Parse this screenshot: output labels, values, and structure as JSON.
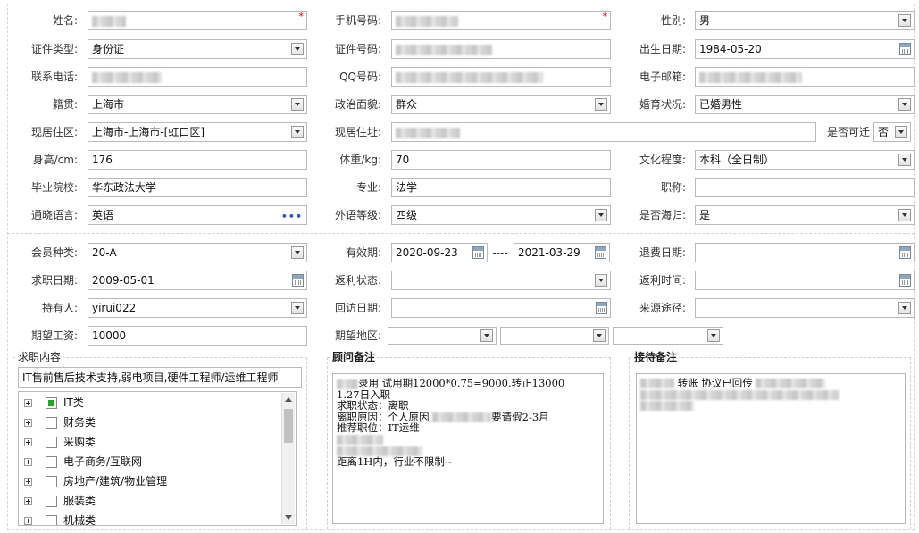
{
  "labels": {
    "name": "姓名:",
    "mobile": "手机号码:",
    "gender": "性别:",
    "id_type": "证件类型:",
    "id_no": "证件号码:",
    "birth": "出生日期:",
    "phone": "联系电话:",
    "qq": "QQ号码:",
    "email": "电子邮箱:",
    "native": "籍贯:",
    "politics": "政治面貌:",
    "marital": "婚育状况:",
    "district": "现居住区:",
    "address": "现居住址:",
    "relocate": "是否可迁",
    "height": "身高/cm:",
    "weight": "体重/kg:",
    "education": "文化程度:",
    "school": "毕业院校:",
    "major": "专业:",
    "title": "职称:",
    "language": "通晓语言:",
    "lang_level": "外语等级:",
    "overseas": "是否海归:",
    "member_type": "会员种类:",
    "valid": "有效期:",
    "refund_date": "退费日期:",
    "job_date": "求职日期:",
    "rebate_status": "返利状态:",
    "rebate_time": "返利时间:",
    "holder": "持有人:",
    "visit_date": "回访日期:",
    "source": "来源途径:",
    "salary": "期望工资:",
    "area": "期望地区:"
  },
  "values": {
    "gender": "男",
    "id_type": "身份证",
    "birth": "1984-05-20",
    "native": "上海市",
    "politics": "群众",
    "marital": "已婚男性",
    "district": "上海市-上海市-[虹口区]",
    "relocate": "否",
    "height": "176",
    "weight": "70",
    "education": "本科（全日制）",
    "school": "华东政法大学",
    "major": "法学",
    "title": "",
    "language": "英语",
    "lang_level": "四级",
    "overseas": "是",
    "member_type": "20-A",
    "valid_from": "2020-09-23",
    "valid_sep": "----",
    "valid_to": "2021-03-29",
    "refund_date": "",
    "job_date": "2009-05-01",
    "rebate_status": "",
    "rebate_time": "",
    "holder": "yirui022",
    "visit_date": "",
    "source": "",
    "salary": "10000"
  },
  "required_mark": "*",
  "job_section": {
    "legend": "求职内容",
    "summary": "IT售前售后技术支持,弱电项目,硬件工程师/运维工程师",
    "tree": [
      {
        "label": "IT类",
        "checked": true
      },
      {
        "label": "财务类",
        "checked": false
      },
      {
        "label": "采购类",
        "checked": false
      },
      {
        "label": "电子商务/互联网",
        "checked": false
      },
      {
        "label": "房地产/建筑/物业管理",
        "checked": false
      },
      {
        "label": "服装类",
        "checked": false
      },
      {
        "label": "机械类",
        "checked": false
      }
    ]
  },
  "advisor_section": {
    "legend": "顾问备注",
    "lines": [
      "录用 试用期12000*0.75=9000,转正13000",
      "1.27日入职",
      "",
      "求职状态：离职",
      "离职原因：个人原因",
      "要请假2-3月",
      "推荐职位：IT运维",
      "距离1H内，行业不限制~"
    ]
  },
  "reception_section": {
    "legend": "接待备注",
    "text": "转账 协议已回传"
  },
  "colors": {
    "required": "#ee0000",
    "checked": "#2aa12a",
    "border": "#b9b9b9"
  },
  "icons": [
    "dropdown-arrow-icon",
    "calendar-icon",
    "ellipsis-icon",
    "expand-plus-icon"
  ]
}
